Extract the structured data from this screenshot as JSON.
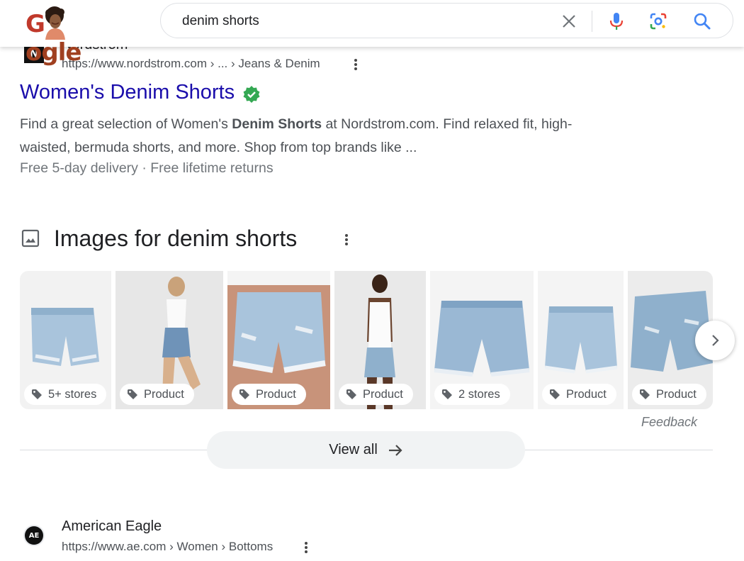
{
  "header": {
    "logo_text_g": "G",
    "logo_text_rest": "ogle",
    "search_query": "denim shorts"
  },
  "result1": {
    "site_name": "Nordstrom",
    "favicon_letter": "N",
    "cite": "https://www.nordstrom.com › ... › Jeans & Denim",
    "title": "Women's Denim Shorts",
    "snippet_before": "Find a great selection of Women's ",
    "snippet_bold": "Denim Shorts",
    "snippet_after": " at Nordstrom.com. Find relaxed fit, high-waisted, bermuda shorts, and more. Shop from top brands like ...",
    "delivery": "Free 5-day delivery · Free lifetime returns"
  },
  "images": {
    "heading": "Images for denim shorts",
    "thumbnails": [
      {
        "label": "5+ stores",
        "subject": "flat-lay denim shorts"
      },
      {
        "label": "Product",
        "subject": "model in white tank and denim shorts"
      },
      {
        "label": "Product",
        "subject": "distressed high-waist denim shorts on model"
      },
      {
        "label": "Product",
        "subject": "model in white tank top and denim shorts"
      },
      {
        "label": "2 stores",
        "subject": "frayed denim shorts"
      },
      {
        "label": "Product",
        "subject": "light wash denim shorts"
      },
      {
        "label": "Product",
        "subject": "ripped denim shorts"
      }
    ],
    "feedback": "Feedback",
    "view_all": "View all"
  },
  "result2": {
    "site_name": "American Eagle",
    "favicon_text": "AE",
    "cite": "https://www.ae.com › Women › Bottoms"
  },
  "colors": {
    "link": "#1a0dab",
    "verified": "#34a853",
    "denim_light": "#a9c4dc",
    "denim_mid": "#7fa3c4"
  }
}
